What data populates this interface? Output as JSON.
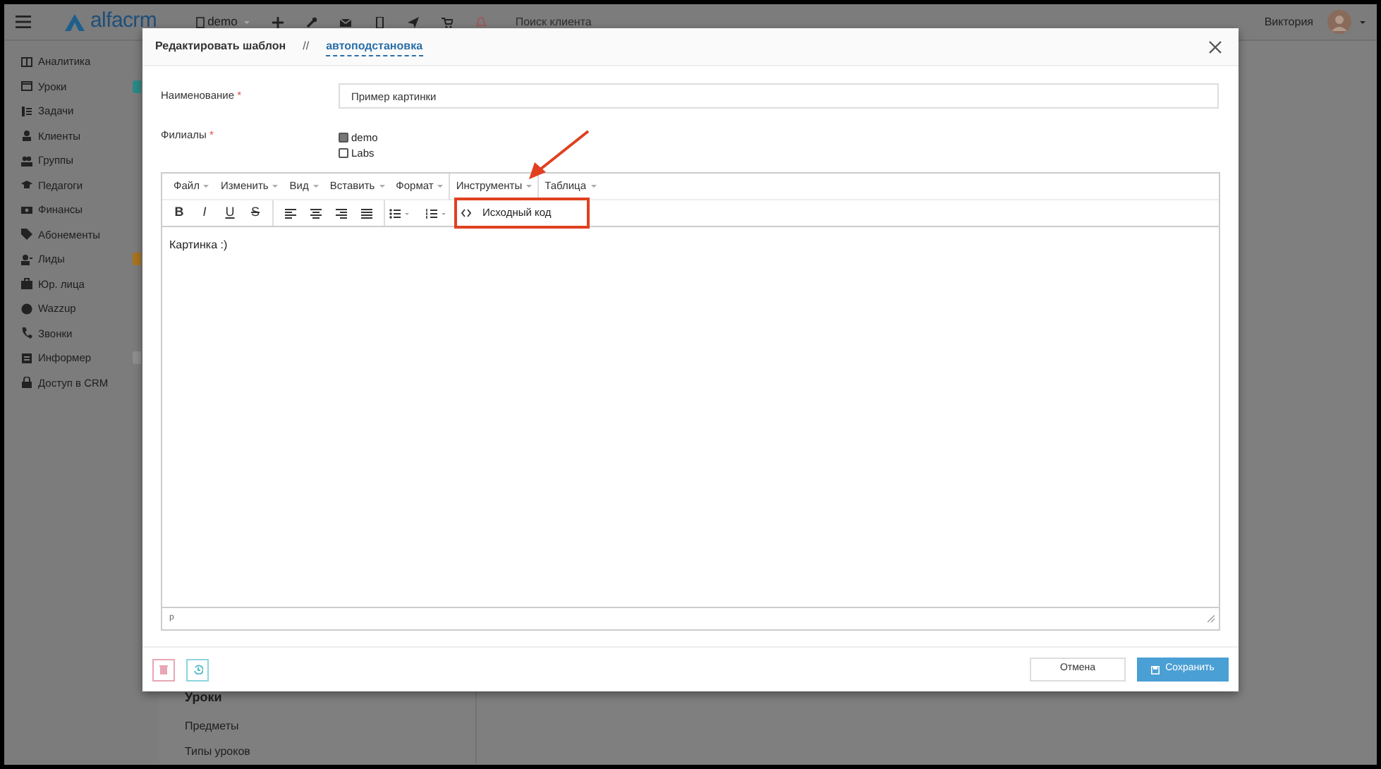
{
  "top_bar": {
    "logo": "alfacrm",
    "branch": "demo",
    "search_placeholder": "Поиск клиента",
    "user": "Виктория"
  },
  "sidebar": {
    "items": [
      {
        "label": "Аналитика"
      },
      {
        "label": "Уроки",
        "color": "#2a8a86"
      },
      {
        "label": "Задачи"
      },
      {
        "label": "Клиенты"
      },
      {
        "label": "Группы"
      },
      {
        "label": "Педагоги"
      },
      {
        "label": "Финансы"
      },
      {
        "label": "Абонементы"
      },
      {
        "label": "Лиды",
        "color": "#a8741e"
      },
      {
        "label": "Юр. лица"
      },
      {
        "label": "Wazzup"
      },
      {
        "label": "Звонки"
      },
      {
        "label": "Информер",
        "color": "#8e8e8e"
      },
      {
        "label": "Доступ в CRM"
      }
    ]
  },
  "background_panel": {
    "heading": "Уроки",
    "links": [
      "Предметы",
      "Типы уроков"
    ]
  },
  "modal": {
    "title": "Редактировать шаблон",
    "separator": "//",
    "link": "автоподстановка",
    "fields": [
      {
        "kind": "text",
        "label": "Наименование",
        "marker": "*",
        "value": "Пример картинки"
      },
      {
        "kind": "checkboxes",
        "label": "Филиалы",
        "marker": "*",
        "options": [
          {
            "label": "demo",
            "checked": true
          },
          {
            "label": "Labs",
            "checked": false
          }
        ]
      }
    ],
    "editor": {
      "menus": [
        {
          "label": "Файл",
          "open": false
        },
        {
          "label": "Изменить",
          "open": false
        },
        {
          "label": "Вид",
          "open": false
        },
        {
          "label": "Вставить",
          "open": false
        },
        {
          "label": "Формат",
          "open": false
        },
        {
          "label": "Инструменты",
          "open": true
        },
        {
          "label": "Таблица",
          "open": false
        }
      ],
      "format_buttons": [
        "B",
        "I",
        "U",
        "S"
      ],
      "dropdown_items": [
        "Исходный код"
      ],
      "content": "Картинка :)",
      "path": "p"
    },
    "cancel_button": "Отмена",
    "save_button": "Сохранить"
  }
}
